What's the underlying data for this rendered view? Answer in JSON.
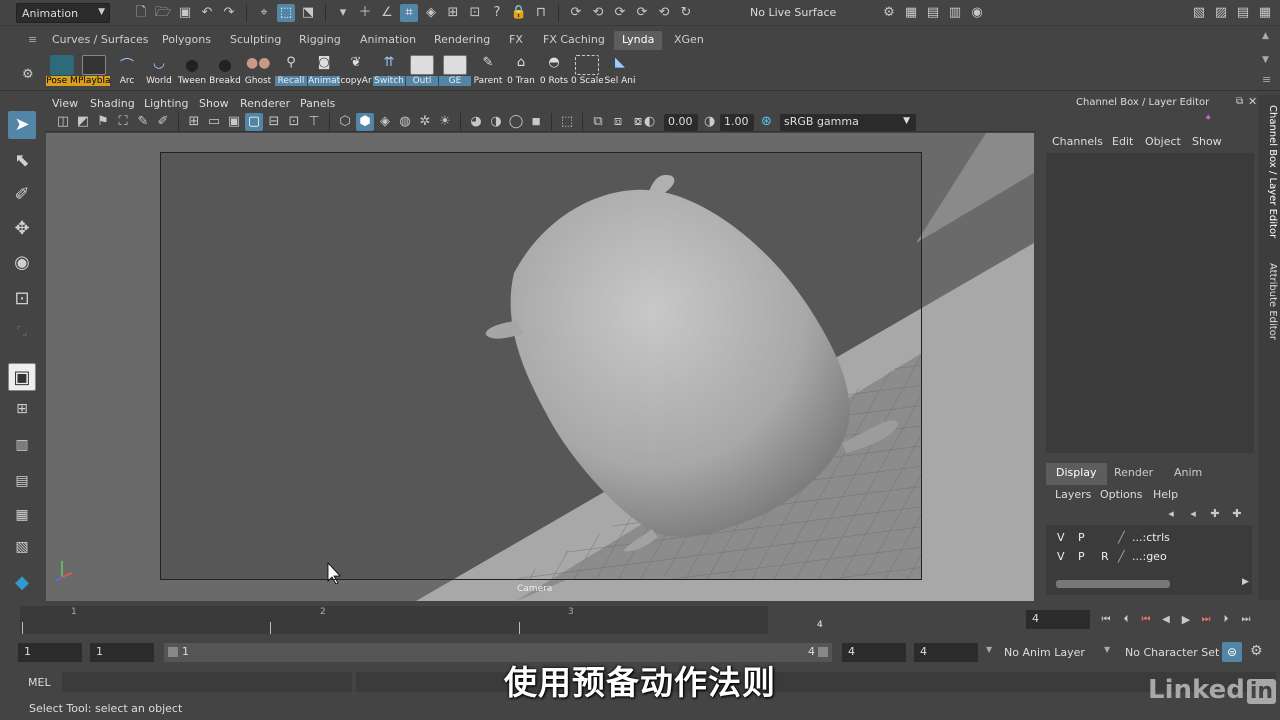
{
  "status_line": {
    "menu_set": "Animation",
    "live_surface": "No Live Surface"
  },
  "shelf_tabs": [
    "Curves / Surfaces",
    "Polygons",
    "Sculpting",
    "Rigging",
    "Animation",
    "Rendering",
    "FX",
    "FX Caching",
    "Lynda",
    "XGen"
  ],
  "active_shelf_tab": "Lynda",
  "shelf_buttons": [
    "Pose M",
    "Playbla",
    "Arc",
    "World",
    "Tween",
    "Breakd",
    "Ghost",
    "Recall",
    "Animat",
    "copyAr",
    "Switch",
    "Outl",
    "GE",
    "Parent",
    "0 Tran",
    "0 Rots",
    "0 Scale",
    "Sel Ani"
  ],
  "panel_menu": [
    "View",
    "Shading",
    "Lighting",
    "Show",
    "Renderer",
    "Panels"
  ],
  "panel_toolbar": {
    "exposure": "0.00",
    "gamma": "1.00",
    "color_space": "sRGB gamma"
  },
  "viewport": {
    "camera_label": "Camera"
  },
  "channel_box": {
    "title": "Channel Box / Layer Editor",
    "menus": [
      "Channels",
      "Edit",
      "Object",
      "Show"
    ]
  },
  "layer_editor": {
    "tabs": [
      "Display",
      "Render",
      "Anim"
    ],
    "active_tab": "Display",
    "menus": [
      "Layers",
      "Options",
      "Help"
    ],
    "layers": [
      {
        "v": "V",
        "p": "P",
        "r": "",
        "name": "...:ctrls"
      },
      {
        "v": "V",
        "p": "P",
        "r": "R",
        "name": "...:geo"
      }
    ]
  },
  "side_tabs": [
    "Channel Box / Layer Editor",
    "Attribute Editor"
  ],
  "time_slider": {
    "ticks": [
      "1",
      "2",
      "3",
      "4"
    ],
    "current_marker": "4",
    "current_time": "4"
  },
  "range_slider": {
    "start": "1",
    "playback_start": "1",
    "range_inner_start": "1",
    "range_inner_end": "4",
    "playback_end": "4",
    "end": "4",
    "anim_layer": "No Anim Layer",
    "character_set": "No Character Set"
  },
  "command_line": {
    "language": "MEL"
  },
  "help_line": "Select Tool: select an object",
  "subtitle": "使用预备动作法则",
  "watermark": "Linked",
  "watermark_in": "in",
  "colors": {
    "highlight": "#5285a6",
    "background": "#444444",
    "viewport_bg": "#6a6a6a"
  }
}
